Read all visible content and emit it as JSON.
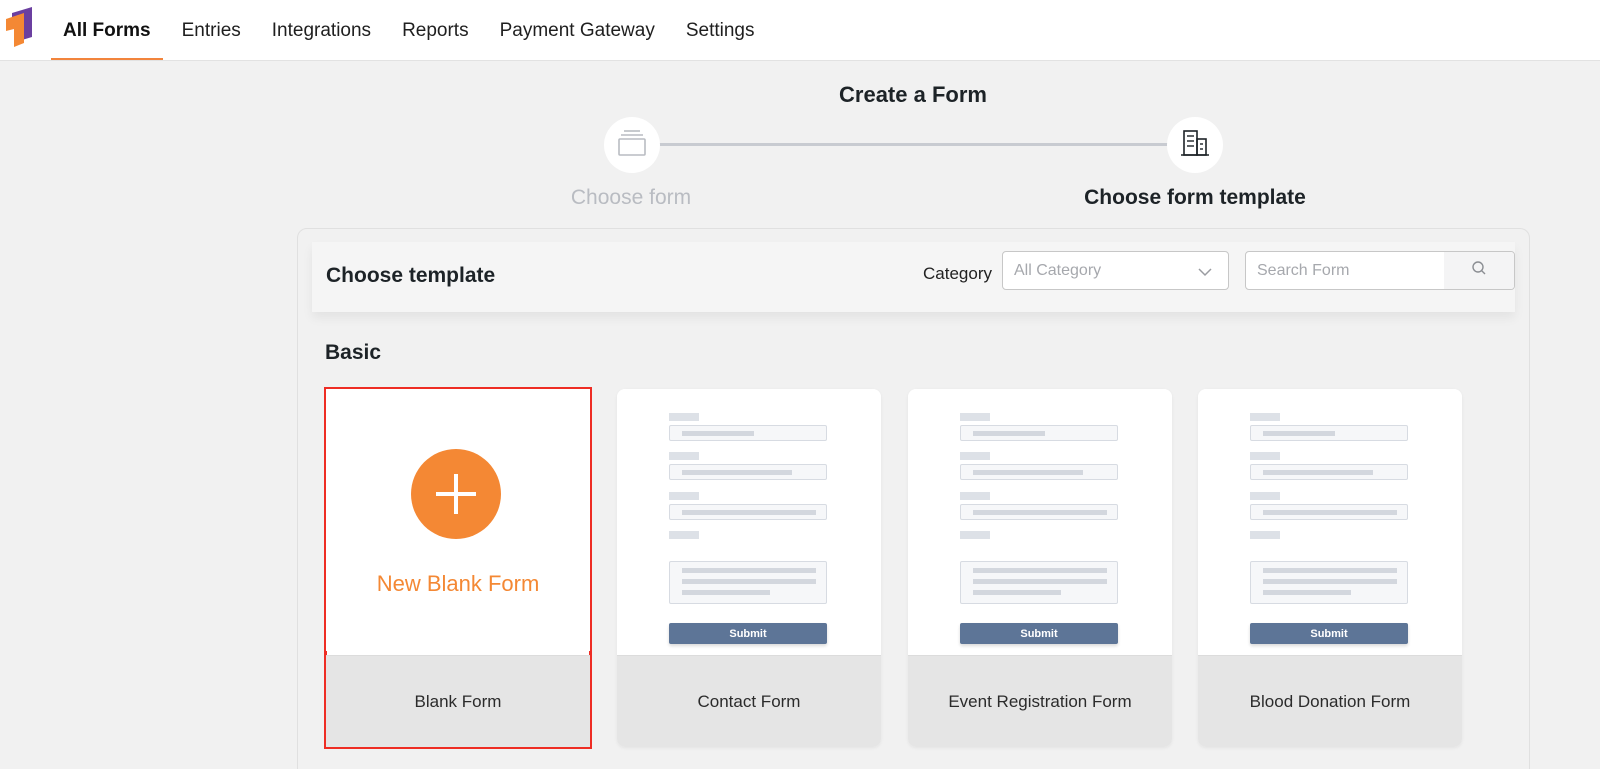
{
  "nav": {
    "items": [
      {
        "label": "All Forms",
        "active": true
      },
      {
        "label": "Entries",
        "active": false
      },
      {
        "label": "Integrations",
        "active": false
      },
      {
        "label": "Reports",
        "active": false
      },
      {
        "label": "Payment Gateway",
        "active": false
      },
      {
        "label": "Settings",
        "active": false
      }
    ]
  },
  "stepper": {
    "title": "Create a Form",
    "steps": [
      {
        "label": "Choose form",
        "icon": "stack-icon",
        "active": false
      },
      {
        "label": "Choose form template",
        "icon": "building-icon",
        "active": true
      }
    ]
  },
  "panel": {
    "title": "Choose template",
    "category_label": "Category",
    "category_value": "All Category",
    "search_placeholder": "Search Form"
  },
  "section": {
    "title": "Basic"
  },
  "templates": [
    {
      "name": "Blank Form",
      "preview_label": "New Blank Form",
      "selected": true
    },
    {
      "name": "Contact Form",
      "submit_label": "Submit"
    },
    {
      "name": "Event Registration Form",
      "submit_label": "Submit"
    },
    {
      "name": "Blood Donation Form",
      "submit_label": "Submit"
    }
  ],
  "colors": {
    "accent": "#f48834",
    "selection_outline": "#ee2d24",
    "submit_button": "#5d7597"
  }
}
